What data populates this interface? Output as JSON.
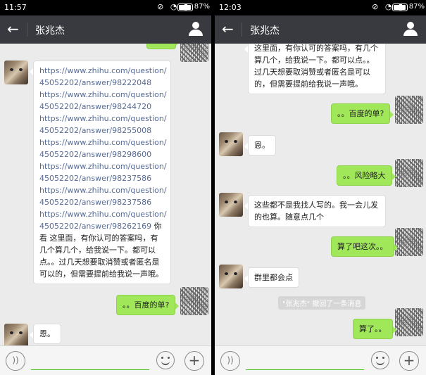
{
  "left_screen": {
    "status": {
      "time": "11:57",
      "battery": "87%"
    },
    "header": {
      "title": "张兆杰"
    },
    "messages": {
      "links": [
        "https://www.zhihu.com/question/",
        "45052202/answer/98222048",
        "https://www.zhihu.com/question/",
        "45052202/answer/98244720",
        "https://www.zhihu.com/question/",
        "45052202/answer/98255008",
        "https://www.zhihu.com/question/",
        "45052202/answer/98298600",
        "https://www.zhihu.com/question/",
        "45052202/answer/98237586",
        "https://www.zhihu.com/question/",
        "45052202/answer/98237586",
        "https://www.zhihu.com/question/",
        "45052202/answer/98262169"
      ],
      "long_text_head": " 你看",
      "long_text_tail": "这里面，有你认可的答案吗，有几个算几个，给我说一下。都可以点。。过几天想要取消赞或者匿名是可以的，但需要提前给我说一声哦。",
      "reply_green": "。。百度的单?",
      "reply_white": "恩。"
    }
  },
  "right_screen": {
    "status": {
      "time": "12:03",
      "battery": "87%"
    },
    "header": {
      "title": "张兆杰"
    },
    "messages": {
      "long_text": "这里面，有你认可的答案吗，有几个算几个，给我说一下。都可以点。。过几天想要取消赞或者匿名是可以的，但需要提前给我说一声哦。",
      "m1": "。。百度的单?",
      "m2": "恩。",
      "m3": "。。风险略大",
      "m4": "这些都不是我找人写的。我一会儿发的也算。随意点几个",
      "m5": "算了吧这次。。",
      "m6": "群里都会点",
      "recall_notice": "\"张兆杰\" 撤回了一条消息",
      "m7": "算了。。"
    }
  },
  "colors": {
    "titlebar": "#393a3f",
    "green_bubble": "#a0e75a",
    "link": "#576b95",
    "input_underline": "#45c01a"
  },
  "icons": {
    "back": "back-arrow-icon",
    "contact": "person-icon",
    "voice": "voice-icon",
    "emoji": "emoji-icon",
    "plus": "plus-icon"
  }
}
